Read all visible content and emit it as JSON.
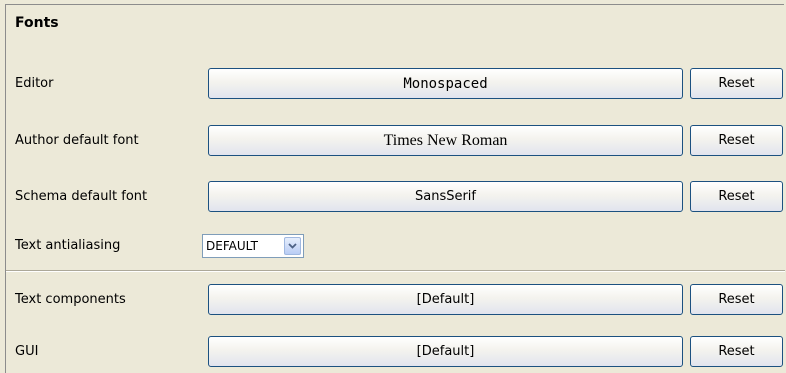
{
  "section": {
    "title": "Fonts"
  },
  "rows": [
    {
      "label": "Editor",
      "font": "Monospaced",
      "reset": "Reset"
    },
    {
      "label": "Author default font",
      "font": "Times New Roman",
      "reset": "Reset"
    },
    {
      "label": "Schema default font",
      "font": "SansSerif",
      "reset": "Reset"
    },
    {
      "label": "Text components",
      "font": "[Default]",
      "reset": "Reset"
    },
    {
      "label": "GUI",
      "font": "[Default]",
      "reset": "Reset"
    }
  ],
  "antialiasing": {
    "label": "Text antialiasing",
    "value": "DEFAULT",
    "icon": "chevron-down-icon"
  },
  "colors": {
    "button_border": "#1c5180",
    "panel_bg": "#ece9d8"
  }
}
